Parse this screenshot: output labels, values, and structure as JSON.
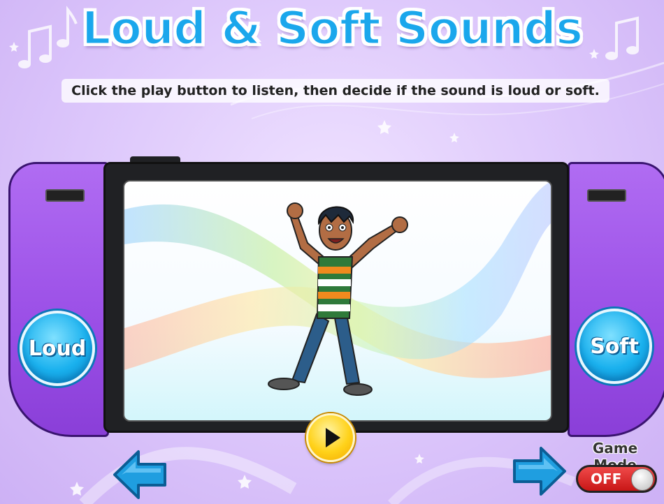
{
  "header": {
    "title": "Loud & Soft Sounds",
    "instruction": "Click the play button to listen, then decide if the sound is loud or soft."
  },
  "answers": {
    "loud_label": "Loud",
    "soft_label": "Soft"
  },
  "game_mode": {
    "label": "Game Mode",
    "state": "OFF"
  },
  "icons": {
    "play": "play-icon",
    "back": "left-arrow-icon",
    "next": "right-arrow-icon",
    "notes": "music-note-icon"
  },
  "colors": {
    "title": "#1aa7ec",
    "console": "#9a4ee6",
    "answer_button": "#1ab1ee",
    "play_button": "#ffd21a",
    "toggle_off": "#d42020"
  }
}
